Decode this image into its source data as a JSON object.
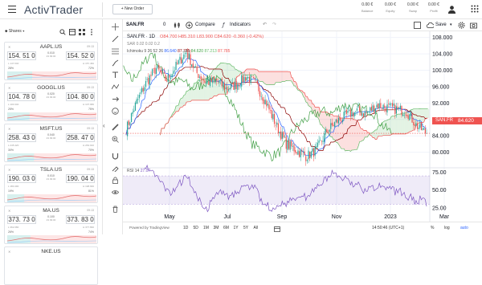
{
  "app": {
    "logo": "ActivTrader",
    "new_order": "New Order"
  },
  "header_stats": [
    {
      "value": "0.00 €",
      "label": "Balance"
    },
    {
      "value": "0.00 €",
      "label": "Equity"
    },
    {
      "value": "0.00 €",
      "label": "Swap"
    },
    {
      "value": "0.00 €",
      "label": "Profit"
    }
  ],
  "watchlist": {
    "title": "Shares",
    "cards": [
      {
        "symbol": "AAPL.US",
        "time": "09:13",
        "bid": "154. 51 0",
        "ask": "154. 52 0",
        "spread": "0.010",
        "spread_label": "23 09:00",
        "low": "L 147.640",
        "high": "H 157.460",
        "pct_left": "28%",
        "pct_right": "72%",
        "fill": 0.28
      },
      {
        "symbol": "GOOGL.US",
        "time": "09:13",
        "bid": "104. 78 0",
        "ask": "104. 80 0",
        "spread": "0.020",
        "spread_label": "23 09:00",
        "low": "L 100.340",
        "high": "H 107.680",
        "pct_left": "25%",
        "pct_right": "75%",
        "fill": 0.25
      },
      {
        "symbol": "MSFT.US",
        "time": "09:13",
        "bid": "258. 43 0",
        "ask": "258. 47 0",
        "spread": "0.040",
        "spread_label": "23 09:00",
        "low": "L 245.420",
        "high": "H 263.910",
        "pct_left": "30%",
        "pct_right": "70%",
        "fill": 0.3
      },
      {
        "symbol": "TSLA.US",
        "time": "09:13",
        "bid": "190. 03 0",
        "ask": "190. 04 0",
        "spread": "0.010",
        "spread_label": "23 09:00",
        "low": "L 180.490",
        "high": "H 198.660",
        "pct_left": "19%",
        "pct_right": "81%",
        "fill": 0.19
      },
      {
        "symbol": "MA.US",
        "time": "09:13",
        "bid": "373. 73 0",
        "ask": "373. 83 0",
        "spread": "0.100",
        "spread_label": "23 09:00",
        "low": "L 362.080",
        "high": "H 377.890",
        "pct_left": "26%",
        "pct_right": "74%",
        "fill": 0.26
      },
      {
        "symbol": "NKE.US",
        "time": "",
        "bid": "",
        "ask": "",
        "spread": "",
        "spread_label": "",
        "low": "",
        "high": "",
        "pct_left": "",
        "pct_right": "",
        "fill": 0
      }
    ]
  },
  "chart_toolbar": {
    "symbol": "SAN.FR",
    "zero": "0",
    "compare": "Compare",
    "indicators": "Indicators",
    "save": "Save"
  },
  "legend": {
    "title": "SAN.FR · 1D",
    "ohlc": "O84.700 H85.310 L83.900 C84.620 -0.360 (-0.42%)",
    "sar": "SAR 0.02 0.02 0.2",
    "ichimoku_label": "Ichimoku 9 26 52 26",
    "ichimoku_values": [
      {
        "v": "86.640",
        "c": "#2962ff"
      },
      {
        "v": "87.785",
        "c": "#8b0000"
      },
      {
        "v": "84.620",
        "c": "#43a047"
      },
      {
        "v": "87.213",
        "c": "#66bb6a"
      },
      {
        "v": "87.785",
        "c": "#ef5350"
      }
    ],
    "rsi_label": "RSI 14",
    "rsi_value": "27.07"
  },
  "last_price": {
    "symbol": "SAN.FR",
    "price": "84.620"
  },
  "colors": {
    "up": "#26a69a",
    "down": "#ef5350",
    "accent": "#2962ff",
    "rsi": "#7e57c2"
  },
  "footer": {
    "credit": "Powered by TradingView",
    "ranges": [
      "1D",
      "5D",
      "1M",
      "3M",
      "6M",
      "1Y",
      "5Y",
      "All"
    ],
    "clock": "14:50:46 (UTC+1)",
    "pct": "%",
    "log": "log",
    "auto": "auto"
  },
  "chart_data": {
    "type": "candlestick",
    "title": "SAN.FR · 1D",
    "x_ticks": [
      "May",
      "Jul",
      "Sep",
      "Nov",
      "2023",
      "Mar"
    ],
    "y_ticks": [
      80,
      84,
      88,
      92,
      96,
      100,
      104,
      108
    ],
    "ylim": [
      76.8,
      109.5
    ],
    "close_path": [
      [
        "Apr start",
        85.5
      ],
      [
        "Apr mid",
        92
      ],
      [
        "Apr end",
        97
      ],
      [
        "May",
        100.5
      ],
      [
        "May mid",
        97.5
      ],
      [
        "May end",
        101
      ],
      [
        "Jun",
        104.5
      ],
      [
        "Jun mid",
        99.5
      ],
      [
        "Jun end",
        97
      ],
      [
        "Jul",
        97.5
      ],
      [
        "Jul mid",
        95.5
      ],
      [
        "Jul end",
        96.5
      ],
      [
        "Aug",
        98.5
      ],
      [
        "Aug mid",
        96.5
      ],
      [
        "Aug end",
        92
      ],
      [
        "Sep",
        86.5
      ],
      [
        "Sep mid",
        82
      ],
      [
        "Sep end",
        80.5
      ],
      [
        "Oct",
        79
      ],
      [
        "Oct mid",
        80.5
      ],
      [
        "Oct end",
        85
      ],
      [
        "Nov",
        87.5
      ],
      [
        "Nov mid",
        89
      ],
      [
        "Nov end",
        90
      ],
      [
        "Dec",
        89.5
      ],
      [
        "Dec mid",
        91.5
      ],
      [
        "Jan",
        91
      ],
      [
        "Jan mid",
        90.5
      ],
      [
        "Jan end",
        90
      ],
      [
        "Feb",
        86.5
      ],
      [
        "Feb mid",
        84.6
      ]
    ],
    "last": 84.62,
    "rsi": {
      "y_ticks": [
        25.0,
        50.0,
        75.0
      ],
      "overbought": 70,
      "oversold": 30,
      "last": 27.07
    }
  }
}
